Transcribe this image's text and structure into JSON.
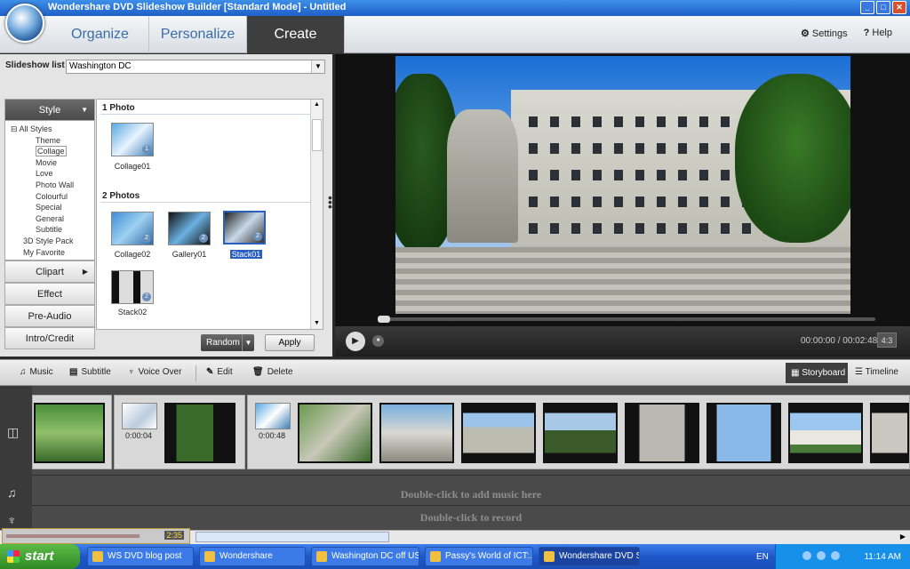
{
  "window": {
    "title": "Wondershare DVD Slideshow Builder [Standard Mode] - Untitled"
  },
  "header": {
    "tabs": [
      {
        "label": "Organize"
      },
      {
        "label": "Personalize"
      },
      {
        "label": "Create"
      }
    ],
    "settings_label": "Settings",
    "help_label": "Help"
  },
  "slideshow": {
    "list_label": "Slideshow list :",
    "selected": "Washington DC"
  },
  "categories": {
    "style": "Style",
    "clipart": "Clipart",
    "effect": "Effect",
    "pre_audio": "Pre-Audio",
    "intro_credit": "Intro/Credit"
  },
  "style_tree": [
    "All Styles",
    "Theme",
    "Collage",
    "Movie",
    "Love",
    "Photo Wall",
    "Colourful",
    "Special",
    "General",
    "Subtitle",
    "3D Style Pack",
    "My Favorite"
  ],
  "thumbs": {
    "section1": "1 Photo",
    "section2": "2 Photos",
    "items": [
      "Collage01",
      "Collage02",
      "Gallery01",
      "Stack01",
      "Stack02"
    ]
  },
  "buttons": {
    "random": "Random",
    "apply": "Apply"
  },
  "preview": {
    "time": "00:00:00 / 00:02:48",
    "ratio": "4:3"
  },
  "toolbar": {
    "music": "Music",
    "subtitle": "Subtitle",
    "voice_over": "Voice Over",
    "edit": "Edit",
    "delete": "Delete",
    "storyboard": "Storyboard",
    "timeline": "Timeline"
  },
  "storyboard": {
    "clip_times": [
      "0:00:04",
      "0:00:48"
    ],
    "music_hint": "Double-click to add music here",
    "record_hint": "Double-click to record",
    "zoom_value": "2:35"
  },
  "taskbar": {
    "start": "start",
    "items": [
      "WS DVD blog post",
      "Wondershare",
      "Washington DC off USB",
      "Passy's World of ICT:...",
      "Wondershare DVD Sli..."
    ],
    "lang": "EN",
    "clock": "11:14 AM"
  }
}
